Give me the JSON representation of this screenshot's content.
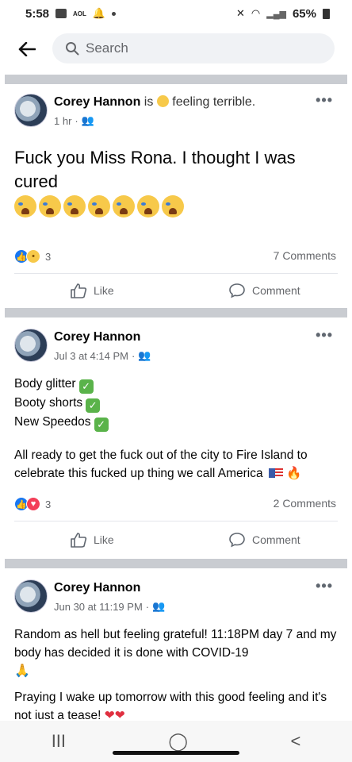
{
  "status_bar": {
    "time": "5:58",
    "carrier_badge": "AOL",
    "battery": "65%",
    "icons": [
      "chat-icon",
      "notification-bell-icon",
      "dot-icon",
      "mute-icon",
      "wifi-icon",
      "signal-icon",
      "battery-icon"
    ]
  },
  "topbar": {
    "back_icon": "arrow-left-icon",
    "search_placeholder": "Search"
  },
  "posts": [
    {
      "author": "Corey Hannon",
      "feeling_prefix": "is",
      "feeling_text": "feeling terrible.",
      "time": "1 hr",
      "audience_icon": "friends-icon",
      "text": "Fuck you Miss Rona. I thought I was cured",
      "emoji_count": 7,
      "reactions": [
        "like",
        "sad"
      ],
      "reaction_count": "3",
      "comments": "7 Comments",
      "like_label": "Like",
      "comment_label": "Comment"
    },
    {
      "author": "Corey Hannon",
      "time": "Jul 3 at 4:14 PM",
      "audience_icon": "friends-icon",
      "lines": [
        "Body glitter",
        "Booty shorts",
        "New Speedos"
      ],
      "paragraph": "All ready to get the fuck out of the city to Fire Island to celebrate this fucked up thing we call America",
      "reactions": [
        "like",
        "love"
      ],
      "reaction_count": "3",
      "comments": "2 Comments",
      "like_label": "Like",
      "comment_label": "Comment"
    },
    {
      "author": "Corey Hannon",
      "time": "Jun 30 at 11:19 PM",
      "audience_icon": "friends-icon",
      "paragraph1": "Random as hell but feeling grateful! 11:18PM day 7 and my body has decided it is done with COVID-19",
      "paragraph2": "Praying I wake up tomorrow with this good feeling and it's not iust a tease!"
    }
  ],
  "navbar": {
    "recent": "III",
    "home": "◯",
    "back": "<"
  },
  "colors": {
    "accent": "#1877f2",
    "divider": "#c9ccd1",
    "muted": "#65676b"
  }
}
